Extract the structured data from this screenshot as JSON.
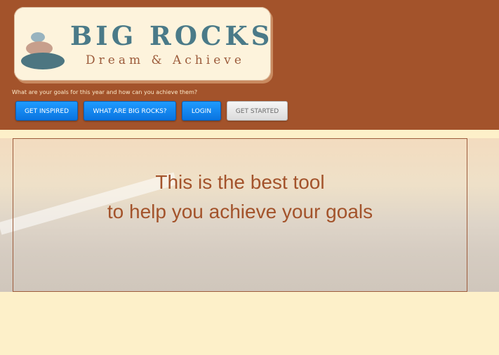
{
  "logo": {
    "title": "BIG ROCKS",
    "subtitle": "Dream & Achieve",
    "stone_colors": [
      "#4d7681",
      "#c79f8c",
      "#98b3bf"
    ]
  },
  "tagline": "What are your goals for this year and how can you achieve them?",
  "nav": {
    "buttons": [
      {
        "label": "GET INSPIRED",
        "style": "blue"
      },
      {
        "label": "WHAT ARE BIG ROCKS?",
        "style": "blue"
      },
      {
        "label": "LOGIN",
        "style": "blue"
      },
      {
        "label": "GET STARTED",
        "style": "gray"
      }
    ]
  },
  "hero": {
    "line1": "This is the best tool",
    "line2": "to help you achieve your goals"
  },
  "colors": {
    "header_bg": "#a3532b",
    "page_bg": "#fdf0c9",
    "accent_text": "#a3532b",
    "button_blue": "#1a8ff5"
  }
}
